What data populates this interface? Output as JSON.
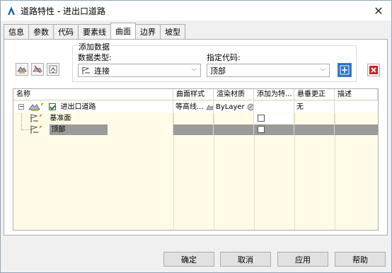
{
  "window": {
    "title": "道路特性 - 进出口道路",
    "close_label": "✕"
  },
  "tabs": [
    {
      "label": "信息"
    },
    {
      "label": "参数"
    },
    {
      "label": "代码"
    },
    {
      "label": "要素线"
    },
    {
      "label": "曲面"
    },
    {
      "label": "边界"
    },
    {
      "label": "坡型"
    }
  ],
  "active_tab": "曲面",
  "add_data": {
    "group_title": "添加数据",
    "data_type_label": "数据类型:",
    "data_type_value": "连接",
    "specify_code_label": "指定代码:",
    "specify_code_value": "顶部"
  },
  "grid": {
    "headers": [
      "名称",
      "曲面样式",
      "渲染材质",
      "添加为特...",
      "悬垂更正",
      "描述"
    ],
    "rows": [
      {
        "name": "进出口道路",
        "style": "等高线...",
        "material": "ByLayer",
        "add_as": "",
        "overhang": "无",
        "desc": ""
      },
      {
        "name": "基准面",
        "style": "",
        "material": "",
        "add_as": "",
        "overhang": "",
        "desc": ""
      },
      {
        "name": "顶部",
        "style": "",
        "material": "",
        "add_as": "",
        "overhang": "",
        "desc": ""
      }
    ]
  },
  "buttons": {
    "ok": "确定",
    "cancel": "取消",
    "apply": "应用",
    "help": "帮助"
  },
  "colors": {
    "accent": "#2a72c9",
    "selected_row": "#9b9b9b",
    "grid_bg": "#fffbe6",
    "delete_red": "#d42020"
  }
}
